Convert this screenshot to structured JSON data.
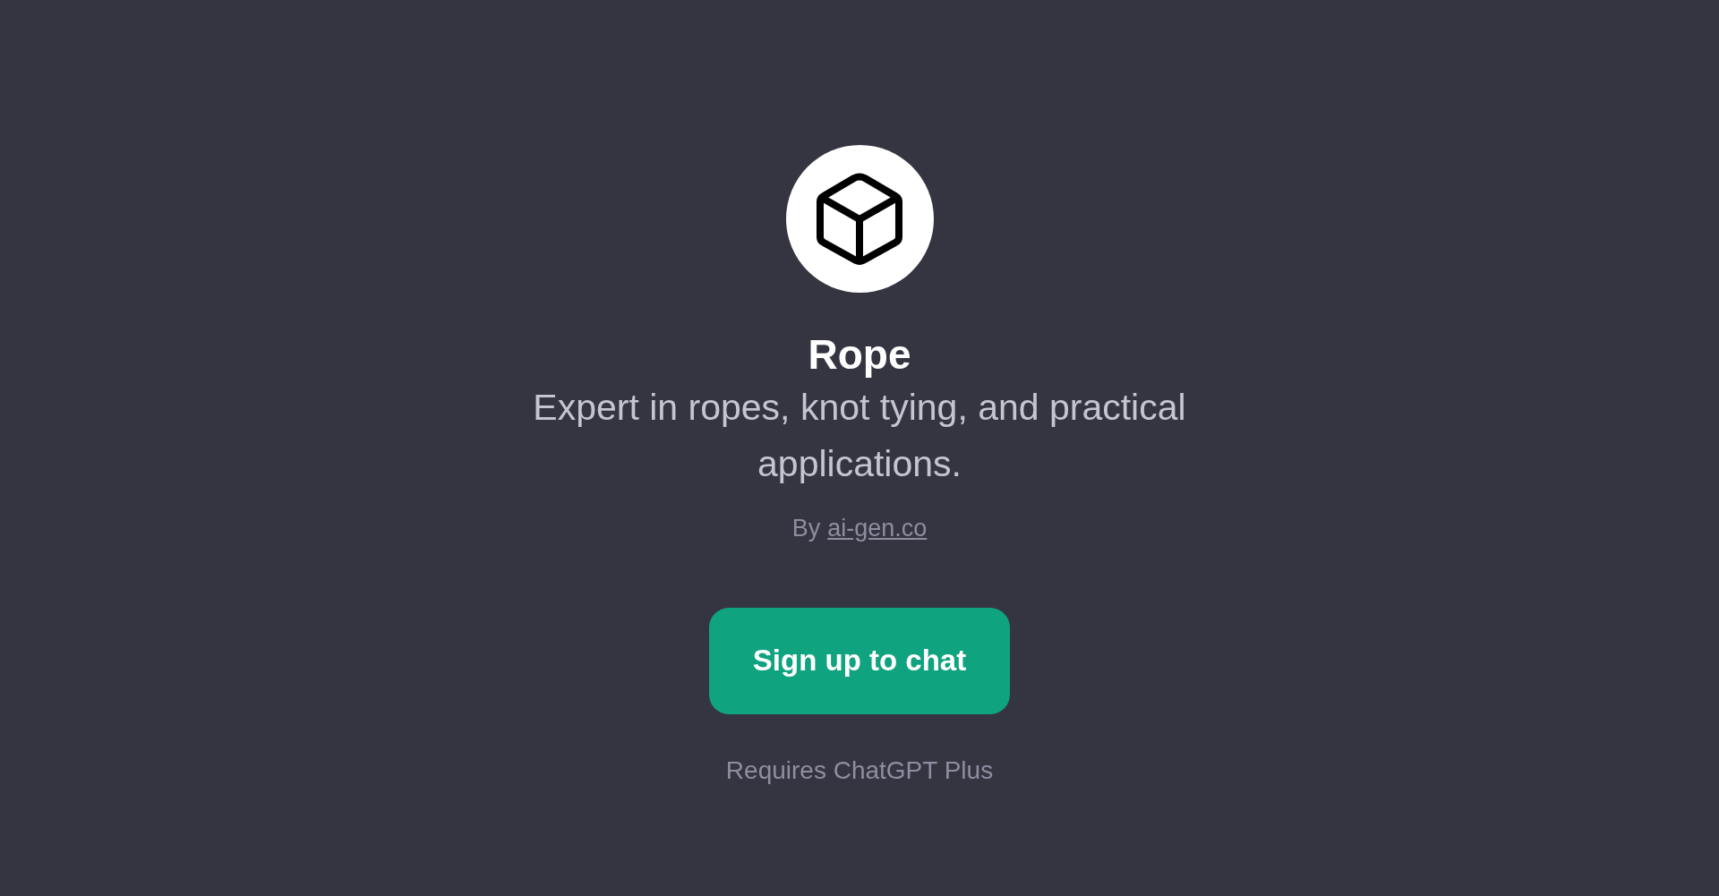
{
  "gpt": {
    "name": "Rope",
    "description": "Expert in ropes, knot tying, and practical applications.",
    "by_prefix": "By",
    "author_link": "ai-gen.co"
  },
  "signup_button": {
    "label": "Sign up to chat"
  },
  "note": "Requires ChatGPT Plus"
}
